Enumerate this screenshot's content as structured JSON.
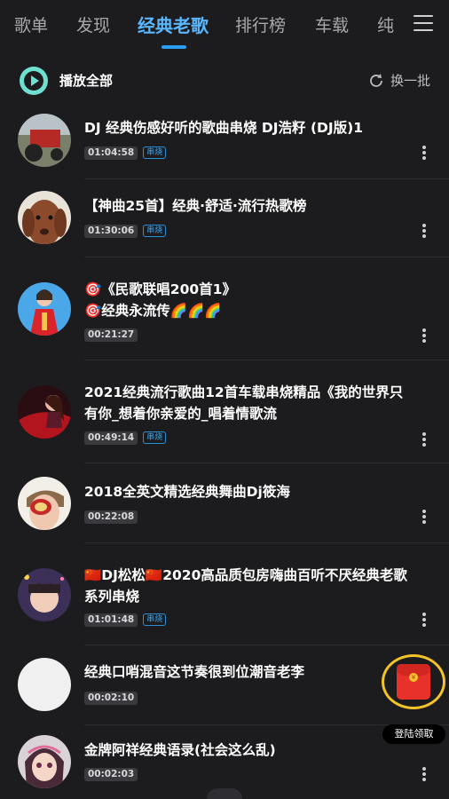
{
  "tabs": [
    "歌单",
    "发现",
    "经典老歌",
    "排行榜",
    "车载",
    "纯"
  ],
  "header": {
    "play_all": "播放全部",
    "shuffle": "换一批"
  },
  "songs": [
    {
      "title": "DJ  经典伤感好听的歌曲串烧 DJ浩籽 (DJ版)1",
      "duration": "01:04:58",
      "tag": "串烧",
      "cover_icon": "tractor-photo"
    },
    {
      "title": "【神曲25首】经典·舒适·流行热歌榜",
      "duration": "01:30:06",
      "tag": "串烧",
      "cover_icon": "dog-photo"
    },
    {
      "title": "🎯《民歌联唱200首1》\n🎯经典永流传🌈🌈🌈",
      "duration": "00:21:27",
      "tag": "",
      "cover_icon": "singer-red-dress-photo"
    },
    {
      "title": "2021经典流行歌曲12首车载串烧精品《我的世界只有你_想着你亲爱的_唱着情歌流",
      "duration": "00:49:14",
      "tag": "串烧",
      "cover_icon": "woman-red-car-photo"
    },
    {
      "title": "2018全英文精选经典舞曲Dj筱海",
      "duration": "00:22:08",
      "tag": "",
      "cover_icon": "masked-face-photo"
    },
    {
      "title": "🇨🇳DJ松松🇨🇳2020高品质包房嗨曲百听不厌经典老歌系列串烧",
      "duration": "01:01:48",
      "tag": "串烧",
      "cover_icon": "man-portrait-photo"
    },
    {
      "title": "经典口哨混音这节奏很到位潮音老李",
      "duration": "00:02:10",
      "tag": "",
      "cover_icon": "blank-cover"
    },
    {
      "title": "金牌阿祥经典语录(社会这么乱)",
      "duration": "00:02:03",
      "tag": "",
      "cover_icon": "cartoon-girl-photo"
    }
  ],
  "promo": {
    "label": "登陆领取",
    "icon": "red-envelope-icon"
  },
  "colors": {
    "accent": "#2a9df4",
    "background": "#1c1c1e",
    "play_button": "#6fe0d0",
    "promo_ring": "#f6c229"
  }
}
